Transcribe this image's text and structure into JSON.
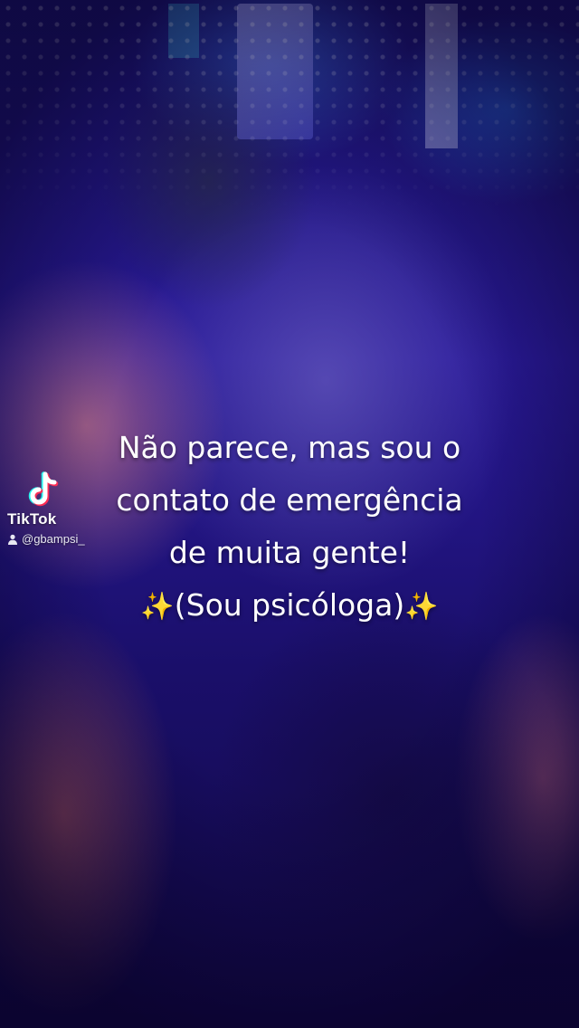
{
  "video": {
    "background": "blurred-nightclub-crowd",
    "colors": {
      "dominant": "#2a1a9a",
      "caption_text": "#ffffff",
      "sparkle": "#ffd84a"
    }
  },
  "watermark": {
    "logo_icon": "tiktok-logo-icon",
    "brand": "TikTok",
    "user_icon": "person-icon",
    "handle": "@gbampsi_"
  },
  "caption": {
    "line1": "Não parece, mas sou o",
    "line2": "contato de emergência",
    "line3": "de muita gente!",
    "line4_sparkle_left": "✨",
    "line4_text": "(Sou psicóloga)",
    "line4_sparkle_right": "✨"
  }
}
